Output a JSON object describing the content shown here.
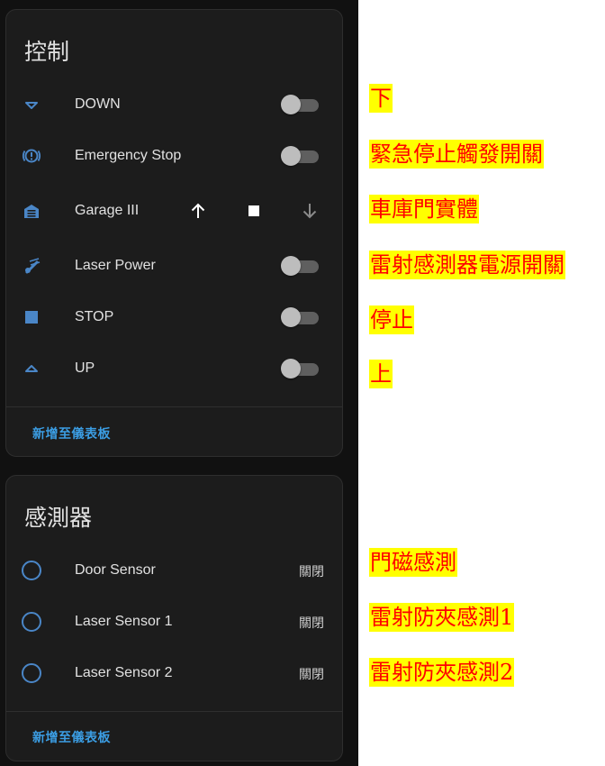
{
  "colors": {
    "background": "#111111",
    "card_bg": "#1c1c1c",
    "icon": "#4a86c7",
    "link": "#3b9de3",
    "note_bg": "#ffff00",
    "note_text": "#ff0000"
  },
  "controls_card": {
    "title": "控制",
    "rows": [
      {
        "icon": "arrow-down-triangle-icon",
        "label": "DOWN",
        "toggle": "off"
      },
      {
        "icon": "emergency-stop-icon",
        "label": "Emergency Stop",
        "toggle": "off"
      },
      {
        "icon": "garage-icon",
        "label": "Garage III",
        "buttons": [
          "arrow-up-icon",
          "stop-square-icon",
          "arrow-down-icon"
        ]
      },
      {
        "icon": "laser-power-icon",
        "label": "Laser Power",
        "toggle": "off"
      },
      {
        "icon": "stop-square-icon",
        "label": "STOP",
        "toggle": "off"
      },
      {
        "icon": "arrow-up-triangle-icon",
        "label": "UP",
        "toggle": "off"
      }
    ],
    "action": "新增至儀表板"
  },
  "sensors_card": {
    "title": "感測器",
    "rows": [
      {
        "icon": "circle-outline-icon",
        "label": "Door Sensor",
        "state": "關閉"
      },
      {
        "icon": "circle-outline-icon",
        "label": "Laser Sensor 1",
        "state": "關閉"
      },
      {
        "icon": "circle-outline-icon",
        "label": "Laser Sensor 2",
        "state": "關閉"
      }
    ],
    "action": "新增至儀表板"
  },
  "annotations": [
    "下",
    "緊急停止觸發開關",
    "車庫門實體",
    "雷射感測器電源開關",
    "停止",
    "上",
    "門磁感測",
    "雷射防夾感測1",
    "雷射防夾感測2"
  ]
}
